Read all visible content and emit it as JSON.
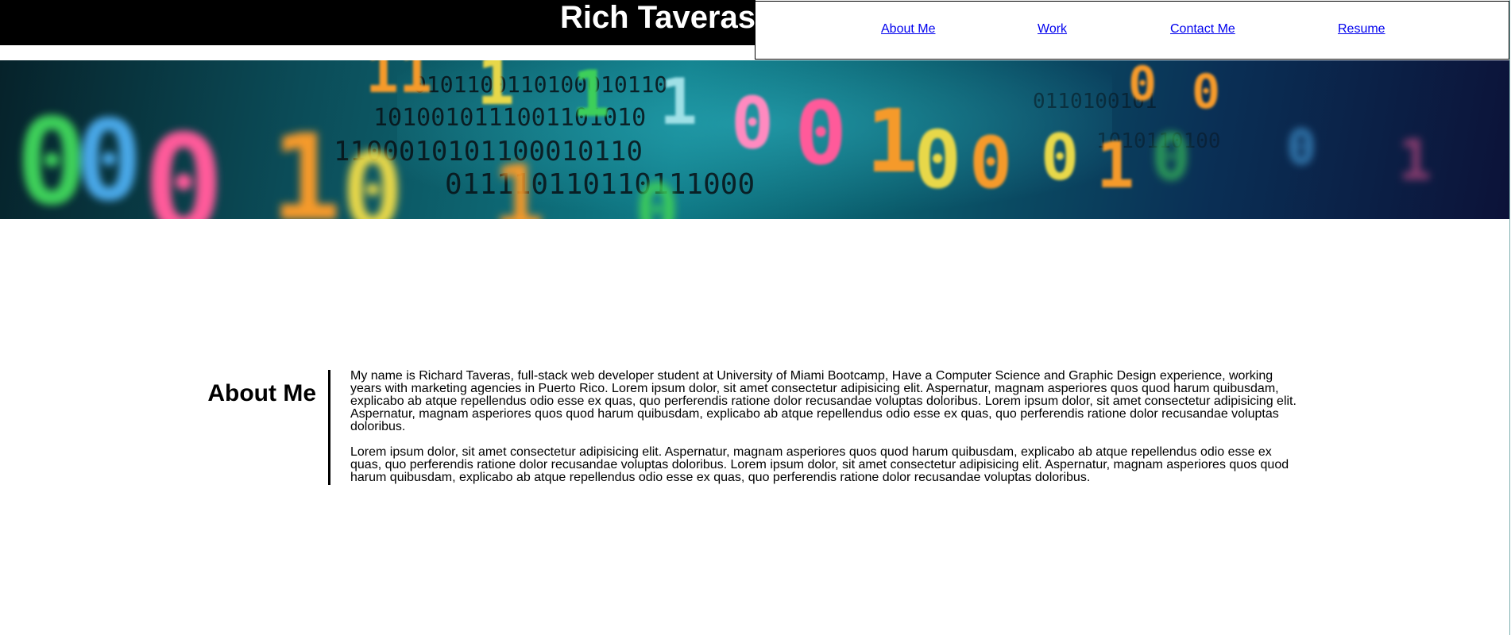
{
  "header": {
    "site_title": "Rich Taveras",
    "nav": [
      {
        "label": "About Me"
      },
      {
        "label": "Work"
      },
      {
        "label": "Contact Me"
      },
      {
        "label": "Resume"
      }
    ]
  },
  "hero": {
    "image_name": "binary-code-banner-image",
    "colors": {
      "green": "#3ecf5a",
      "orange": "#f59a2a",
      "pink": "#ff5a9a",
      "blue": "#4aa8e8",
      "yellow": "#e8d84a",
      "digits": "#0a1014"
    }
  },
  "about": {
    "heading": "About Me",
    "paragraphs": [
      "My name is Richard Taveras, full-stack web developer student at University of Miami Bootcamp, Have a Computer Science and Graphic Design experience, working years with marketing agencies in Puerto Rico. Lorem ipsum dolor, sit amet consectetur adipisicing elit. Aspernatur, magnam asperiores quos quod harum quibusdam, explicabo ab atque repellendus odio esse ex quas, quo perferendis ratione dolor recusandae voluptas doloribus. Lorem ipsum dolor, sit amet consectetur adipisicing elit. Aspernatur, magnam asperiores quos quod harum quibusdam, explicabo ab atque repellendus odio esse ex quas, quo perferendis ratione dolor recusandae voluptas doloribus.",
      "Lorem ipsum dolor, sit amet consectetur adipisicing elit. Aspernatur, magnam asperiores quos quod harum quibusdam, explicabo ab atque repellendus odio esse ex quas, quo perferendis ratione dolor recusandae voluptas doloribus. Lorem ipsum dolor, sit amet consectetur adipisicing elit. Aspernatur, magnam asperiores quos quod harum quibusdam, explicabo ab atque repellendus odio esse ex quas, quo perferendis ratione dolor recusandae voluptas doloribus."
    ]
  }
}
